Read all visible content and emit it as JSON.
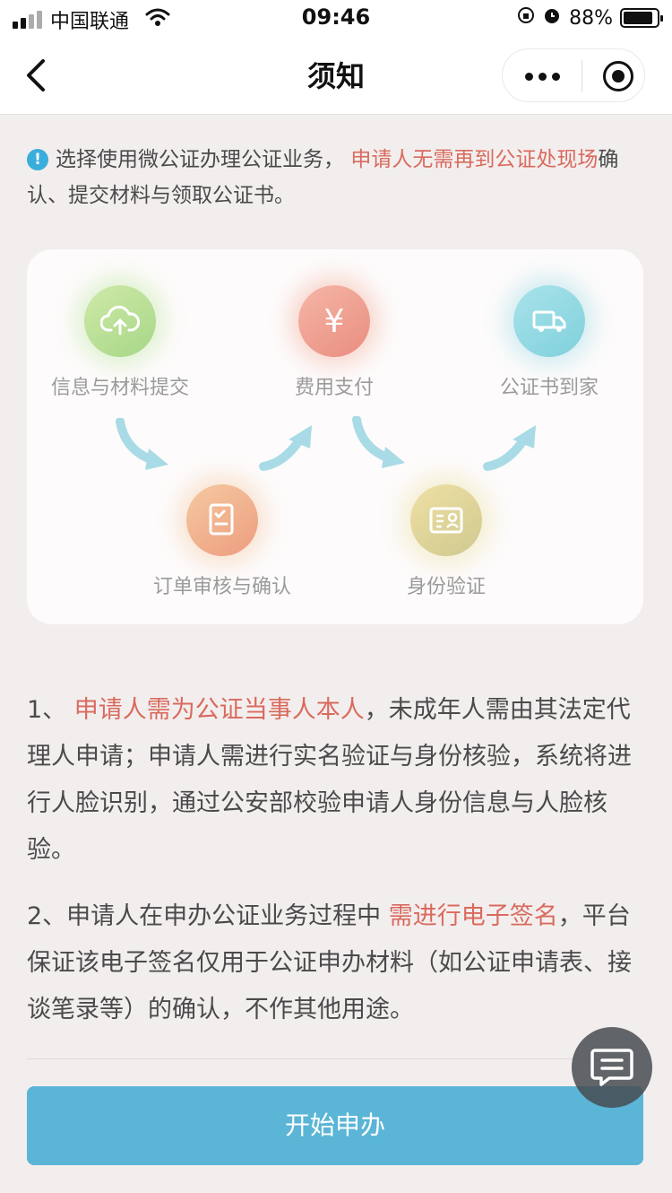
{
  "status_bar": {
    "carrier": "中国联通",
    "time": "09:46",
    "battery": "88%",
    "battery_level": 0.88
  },
  "nav": {
    "title": "须知"
  },
  "notice": {
    "text_before": "选择使用微公证办理公证业务，",
    "highlight": "申请人无需再到公证处现场",
    "text_after": "确认、提交材料与领取公证书。"
  },
  "process": {
    "steps": [
      {
        "label": "信息与材料提交",
        "icon": "cloud-upload-icon",
        "color": "#a6d787"
      },
      {
        "label": "费用支付",
        "icon": "yen-icon",
        "color": "#e98d80"
      },
      {
        "label": "公证书到家",
        "icon": "delivery-truck-icon",
        "color": "#7fd0dc"
      },
      {
        "label": "订单审核与确认",
        "icon": "document-check-icon",
        "color": "#ec9d7f"
      },
      {
        "label": "身份验证",
        "icon": "id-card-icon",
        "color": "#cfc98f"
      }
    ],
    "arrow_color": "#a8dbe6"
  },
  "terms": [
    {
      "prefix": "1、 ",
      "highlight": "申请人需为公证当事人本人",
      "suffix": "，未成年人需由其法定代理人申请；申请人需进行实名验证与身份核验，系统将进行人脸识别，通过公安部校验申请人身份信息与人脸核验。"
    },
    {
      "prefix": "2、申请人在申办公证业务过程中 ",
      "highlight": "需进行电子签名",
      "suffix": "，平台保证该电子签名仅用于公证申办材料（如公证申请表、接谈笔录等）的确认，不作其他用途。"
    }
  ],
  "start_button": {
    "label": "开始申办"
  },
  "colors": {
    "accent": "#5bb5d6",
    "highlight": "#d96a5e",
    "info": "#3aaedb"
  }
}
